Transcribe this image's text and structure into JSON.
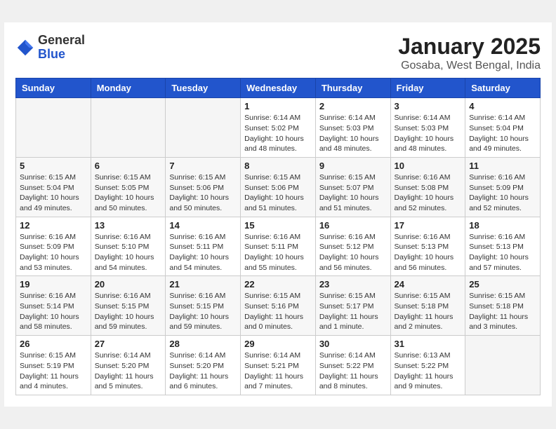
{
  "header": {
    "logo_general": "General",
    "logo_blue": "Blue",
    "month_title": "January 2025",
    "location": "Gosaba, West Bengal, India"
  },
  "days_of_week": [
    "Sunday",
    "Monday",
    "Tuesday",
    "Wednesday",
    "Thursday",
    "Friday",
    "Saturday"
  ],
  "weeks": [
    [
      {
        "day": "",
        "info": ""
      },
      {
        "day": "",
        "info": ""
      },
      {
        "day": "",
        "info": ""
      },
      {
        "day": "1",
        "info": "Sunrise: 6:14 AM\nSunset: 5:02 PM\nDaylight: 10 hours\nand 48 minutes."
      },
      {
        "day": "2",
        "info": "Sunrise: 6:14 AM\nSunset: 5:03 PM\nDaylight: 10 hours\nand 48 minutes."
      },
      {
        "day": "3",
        "info": "Sunrise: 6:14 AM\nSunset: 5:03 PM\nDaylight: 10 hours\nand 48 minutes."
      },
      {
        "day": "4",
        "info": "Sunrise: 6:14 AM\nSunset: 5:04 PM\nDaylight: 10 hours\nand 49 minutes."
      }
    ],
    [
      {
        "day": "5",
        "info": "Sunrise: 6:15 AM\nSunset: 5:04 PM\nDaylight: 10 hours\nand 49 minutes."
      },
      {
        "day": "6",
        "info": "Sunrise: 6:15 AM\nSunset: 5:05 PM\nDaylight: 10 hours\nand 50 minutes."
      },
      {
        "day": "7",
        "info": "Sunrise: 6:15 AM\nSunset: 5:06 PM\nDaylight: 10 hours\nand 50 minutes."
      },
      {
        "day": "8",
        "info": "Sunrise: 6:15 AM\nSunset: 5:06 PM\nDaylight: 10 hours\nand 51 minutes."
      },
      {
        "day": "9",
        "info": "Sunrise: 6:15 AM\nSunset: 5:07 PM\nDaylight: 10 hours\nand 51 minutes."
      },
      {
        "day": "10",
        "info": "Sunrise: 6:16 AM\nSunset: 5:08 PM\nDaylight: 10 hours\nand 52 minutes."
      },
      {
        "day": "11",
        "info": "Sunrise: 6:16 AM\nSunset: 5:09 PM\nDaylight: 10 hours\nand 52 minutes."
      }
    ],
    [
      {
        "day": "12",
        "info": "Sunrise: 6:16 AM\nSunset: 5:09 PM\nDaylight: 10 hours\nand 53 minutes."
      },
      {
        "day": "13",
        "info": "Sunrise: 6:16 AM\nSunset: 5:10 PM\nDaylight: 10 hours\nand 54 minutes."
      },
      {
        "day": "14",
        "info": "Sunrise: 6:16 AM\nSunset: 5:11 PM\nDaylight: 10 hours\nand 54 minutes."
      },
      {
        "day": "15",
        "info": "Sunrise: 6:16 AM\nSunset: 5:11 PM\nDaylight: 10 hours\nand 55 minutes."
      },
      {
        "day": "16",
        "info": "Sunrise: 6:16 AM\nSunset: 5:12 PM\nDaylight: 10 hours\nand 56 minutes."
      },
      {
        "day": "17",
        "info": "Sunrise: 6:16 AM\nSunset: 5:13 PM\nDaylight: 10 hours\nand 56 minutes."
      },
      {
        "day": "18",
        "info": "Sunrise: 6:16 AM\nSunset: 5:13 PM\nDaylight: 10 hours\nand 57 minutes."
      }
    ],
    [
      {
        "day": "19",
        "info": "Sunrise: 6:16 AM\nSunset: 5:14 PM\nDaylight: 10 hours\nand 58 minutes."
      },
      {
        "day": "20",
        "info": "Sunrise: 6:16 AM\nSunset: 5:15 PM\nDaylight: 10 hours\nand 59 minutes."
      },
      {
        "day": "21",
        "info": "Sunrise: 6:16 AM\nSunset: 5:15 PM\nDaylight: 10 hours\nand 59 minutes."
      },
      {
        "day": "22",
        "info": "Sunrise: 6:15 AM\nSunset: 5:16 PM\nDaylight: 11 hours\nand 0 minutes."
      },
      {
        "day": "23",
        "info": "Sunrise: 6:15 AM\nSunset: 5:17 PM\nDaylight: 11 hours\nand 1 minute."
      },
      {
        "day": "24",
        "info": "Sunrise: 6:15 AM\nSunset: 5:18 PM\nDaylight: 11 hours\nand 2 minutes."
      },
      {
        "day": "25",
        "info": "Sunrise: 6:15 AM\nSunset: 5:18 PM\nDaylight: 11 hours\nand 3 minutes."
      }
    ],
    [
      {
        "day": "26",
        "info": "Sunrise: 6:15 AM\nSunset: 5:19 PM\nDaylight: 11 hours\nand 4 minutes."
      },
      {
        "day": "27",
        "info": "Sunrise: 6:14 AM\nSunset: 5:20 PM\nDaylight: 11 hours\nand 5 minutes."
      },
      {
        "day": "28",
        "info": "Sunrise: 6:14 AM\nSunset: 5:20 PM\nDaylight: 11 hours\nand 6 minutes."
      },
      {
        "day": "29",
        "info": "Sunrise: 6:14 AM\nSunset: 5:21 PM\nDaylight: 11 hours\nand 7 minutes."
      },
      {
        "day": "30",
        "info": "Sunrise: 6:14 AM\nSunset: 5:22 PM\nDaylight: 11 hours\nand 8 minutes."
      },
      {
        "day": "31",
        "info": "Sunrise: 6:13 AM\nSunset: 5:22 PM\nDaylight: 11 hours\nand 9 minutes."
      },
      {
        "day": "",
        "info": ""
      }
    ]
  ]
}
